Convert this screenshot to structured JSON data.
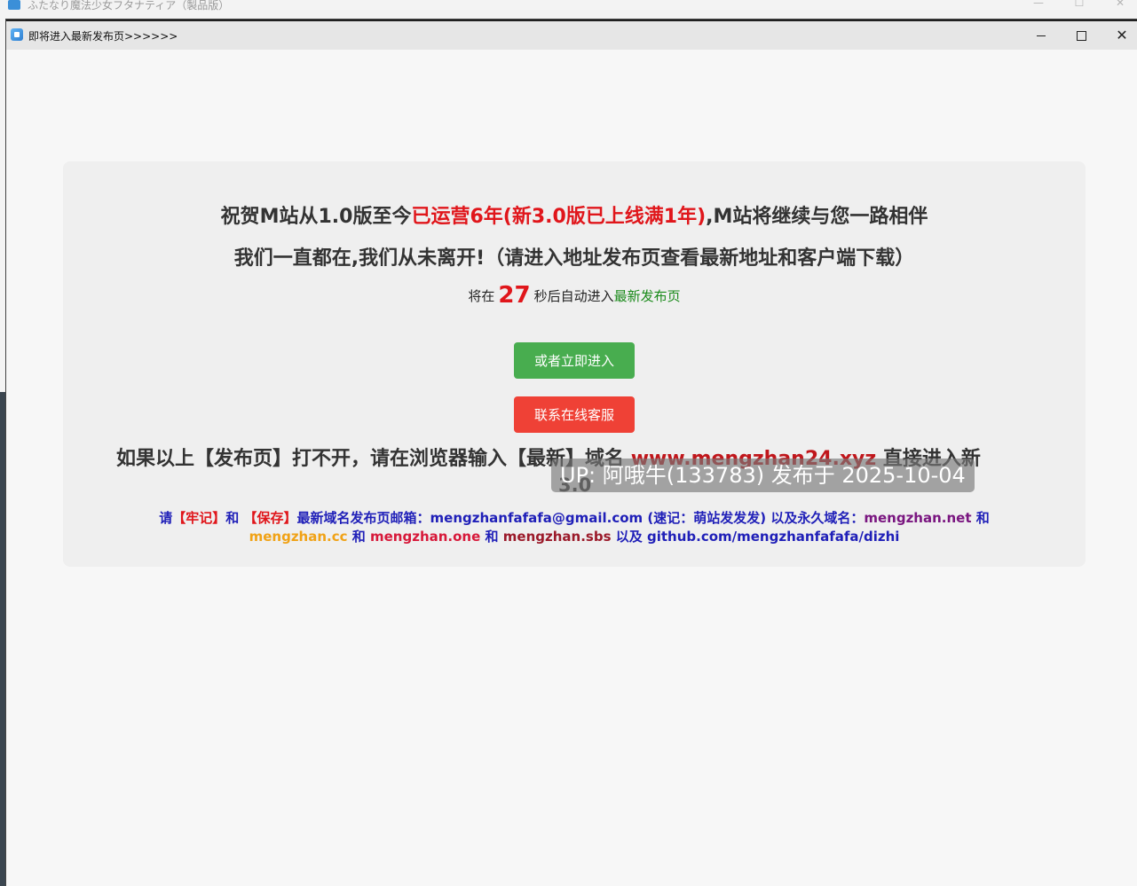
{
  "back_window": {
    "title": "ふたなり魔法少女フタナティア（製品版）",
    "minimize": "—",
    "maximize": "☐",
    "close": "✕"
  },
  "window": {
    "title": "即将进入最新发布页>>>>>>",
    "icon": "app-icon",
    "minimize_icon": "minimize-icon",
    "maximize_icon": "maximize-icon",
    "close_icon": "close-icon"
  },
  "headline1": {
    "part1": "祝贺M站从1.0版至今",
    "part2_red": "已运营6年(新3.0版已上线满1年)",
    "part3": ",M站将继续与您一路相伴"
  },
  "headline2": "我们一直都在,我们从未离开!（请进入地址发布页查看最新地址和客户端下载）",
  "countdown": {
    "prefix": "将在",
    "seconds": "27",
    "suffix": "秒后自动进入",
    "link": "最新发布页"
  },
  "buttons": {
    "enter_now": "或者立即进入",
    "contact_support": "联系在线客服"
  },
  "domain_notice": {
    "prefix": "如果以上【发布页】打不开，请在浏览器输入【最新】域名",
    "domain": "www.mengzhan24.xyz",
    "suffix": "直接进入新",
    "line2": "3.0"
  },
  "watermark": "UP: 阿哦牛(133783) 发布于 2025-10-04",
  "info": {
    "please": "请",
    "remember": "【牢记】",
    "and1": "和",
    "save": "【保存】",
    "email_label": "最新域名发布页邮箱：mengzhanfafafa@gmail.com (速记：萌站发发发) 以及永久域名：",
    "domain_net": "mengzhan.net",
    "and2": "和",
    "domain_cc": "mengzhan.cc",
    "and3": "和",
    "domain_one": "mengzhan.one",
    "and4": "和",
    "domain_sbs": "mengzhan.sbs",
    "github": "以及 github.com/mengzhanfafafa/dizhi"
  },
  "colors": {
    "accent_red": "#e0161b",
    "green_button": "#48ad4f",
    "red_button": "#ef4136",
    "info_blue": "#1f1fb8"
  }
}
